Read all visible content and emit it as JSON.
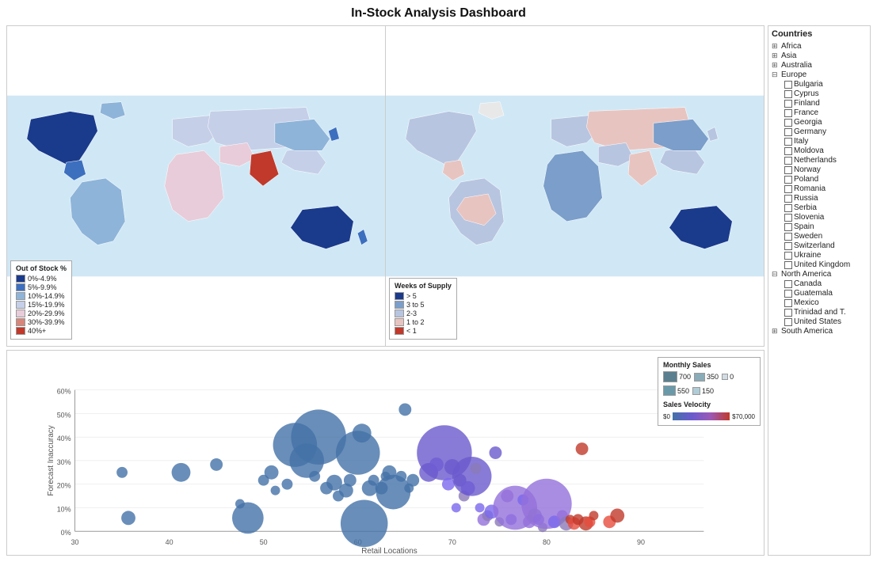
{
  "title": "In-Stock Analysis Dashboard",
  "maps": {
    "left_legend": {
      "title": "Out of Stock %",
      "items": [
        {
          "label": "0%-4.9%",
          "color": "#1a3a8c"
        },
        {
          "label": "5%-9.9%",
          "color": "#3d6fbf"
        },
        {
          "label": "10%-14.9%",
          "color": "#8eb4d9"
        },
        {
          "label": "15%-19.9%",
          "color": "#c5cfe8"
        },
        {
          "label": "20%-29.9%",
          "color": "#e8ccd9"
        },
        {
          "label": "30%-39.9%",
          "color": "#d9857a"
        },
        {
          "label": "40%+",
          "color": "#c0392b"
        }
      ]
    },
    "right_legend": {
      "title": "Weeks of Supply",
      "items": [
        {
          "label": "> 5",
          "color": "#1a3a8c"
        },
        {
          "label": "3 to 5",
          "color": "#7b9eca"
        },
        {
          "label": "2-3",
          "color": "#b8c5e0"
        },
        {
          "label": "1 to 2",
          "color": "#e8c4c0"
        },
        {
          "label": "< 1",
          "color": "#c0392b"
        }
      ]
    }
  },
  "scatter": {
    "x_axis_label": "Retail Locations",
    "y_axis_label": "Forecast Inaccuracy",
    "x_ticks": [
      "30",
      "40",
      "50",
      "60",
      "70",
      "80",
      "90"
    ],
    "y_ticks": [
      "0%",
      "10%",
      "20%",
      "30%",
      "40%",
      "50%",
      "60%"
    ]
  },
  "scatter_legend": {
    "title": "Monthly Sales",
    "items": [
      {
        "label": "700",
        "color": "#5b7f8f"
      },
      {
        "label": "350",
        "color": "#8aabb8"
      },
      {
        "label": "0",
        "color": "#d0dde3"
      },
      {
        "label": "550",
        "color": "#6a9aaa"
      },
      {
        "label": "150",
        "color": "#b0ccd5"
      }
    ],
    "velocity_title": "Sales Velocity",
    "velocity_min": "$0",
    "velocity_max": "$70,000"
  },
  "sidebar": {
    "title": "Countries",
    "groups": [
      {
        "label": "Africa",
        "expanded": false,
        "children": []
      },
      {
        "label": "Asia",
        "expanded": false,
        "children": []
      },
      {
        "label": "Australia",
        "expanded": false,
        "children": []
      },
      {
        "label": "Europe",
        "expanded": true,
        "children": [
          "Bulgaria",
          "Cyprus",
          "Finland",
          "France",
          "Georgia",
          "Germany",
          "Italy",
          "Moldova",
          "Netherlands",
          "Norway",
          "Poland",
          "Romania",
          "Russia",
          "Serbia",
          "Slovenia",
          "Spain",
          "Sweden",
          "Switzerland",
          "Ukraine",
          "United Kingdom"
        ]
      },
      {
        "label": "North America",
        "expanded": true,
        "children": [
          "Canada",
          "Guatemala",
          "Mexico",
          "Trinidad and T.",
          "United States"
        ]
      },
      {
        "label": "South America",
        "expanded": false,
        "children": []
      }
    ]
  }
}
